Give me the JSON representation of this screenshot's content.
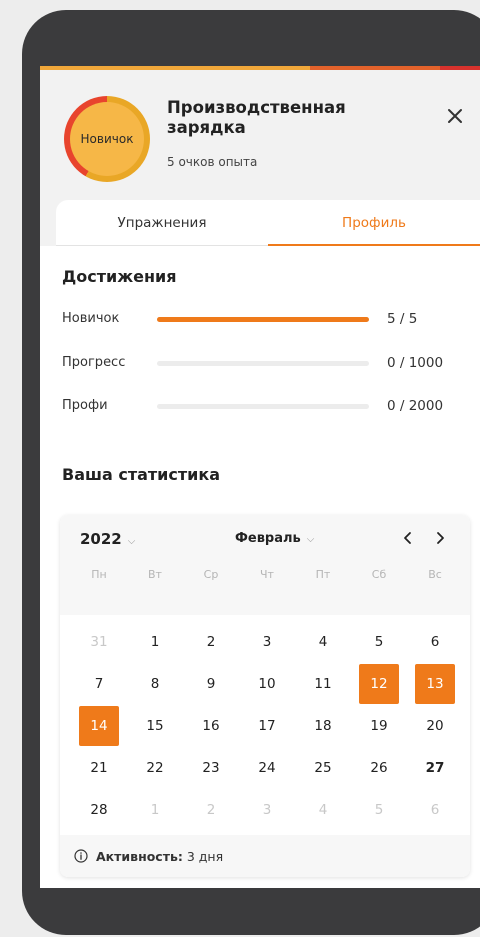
{
  "header": {
    "badge_label": "Новичок",
    "title": "Производственная зарядка",
    "xp": "5 очков опыта"
  },
  "tabs": [
    {
      "label": "Упражнения",
      "active": false
    },
    {
      "label": "Профиль",
      "active": true
    }
  ],
  "achievements": {
    "title": "Достижения",
    "items": [
      {
        "label": "Новичок",
        "value": "5 / 5",
        "progress": 1.0
      },
      {
        "label": "Прогресс",
        "value": "0 / 1000",
        "progress": 0
      },
      {
        "label": "Профи",
        "value": "0 / 2000",
        "progress": 0
      }
    ]
  },
  "stats": {
    "title": "Ваша статистика",
    "calendar": {
      "year": "2022",
      "month": "Февраль",
      "weekdays": [
        "Пн",
        "Вт",
        "Ср",
        "Чт",
        "Пт",
        "Сб",
        "Вс"
      ],
      "days": [
        {
          "d": "31",
          "muted": true
        },
        {
          "d": "1"
        },
        {
          "d": "2"
        },
        {
          "d": "3"
        },
        {
          "d": "4"
        },
        {
          "d": "5"
        },
        {
          "d": "6"
        },
        {
          "d": "7"
        },
        {
          "d": "8"
        },
        {
          "d": "9"
        },
        {
          "d": "10"
        },
        {
          "d": "11"
        },
        {
          "d": "12",
          "selected": true
        },
        {
          "d": "13",
          "selected": true
        },
        {
          "d": "14",
          "selected": true
        },
        {
          "d": "15"
        },
        {
          "d": "16"
        },
        {
          "d": "17"
        },
        {
          "d": "18"
        },
        {
          "d": "19"
        },
        {
          "d": "20"
        },
        {
          "d": "21"
        },
        {
          "d": "22"
        },
        {
          "d": "23"
        },
        {
          "d": "24"
        },
        {
          "d": "25"
        },
        {
          "d": "26"
        },
        {
          "d": "27",
          "bold": true
        },
        {
          "d": "28"
        },
        {
          "d": "1",
          "muted": true
        },
        {
          "d": "2",
          "muted": true
        },
        {
          "d": "3",
          "muted": true
        },
        {
          "d": "4",
          "muted": true
        },
        {
          "d": "5",
          "muted": true
        },
        {
          "d": "6",
          "muted": true
        }
      ]
    },
    "activity_label": "Активность:",
    "activity_value": "3 дня"
  },
  "colors": {
    "accent": "#ef7a1a",
    "badge": "#f6b747",
    "badge_ring_red": "#e8442d",
    "badge_ring_yellow": "#e9a726"
  },
  "icons": {
    "close": "close-icon",
    "prev": "chevron-left-icon",
    "next": "chevron-right-icon",
    "info": "info-icon"
  }
}
